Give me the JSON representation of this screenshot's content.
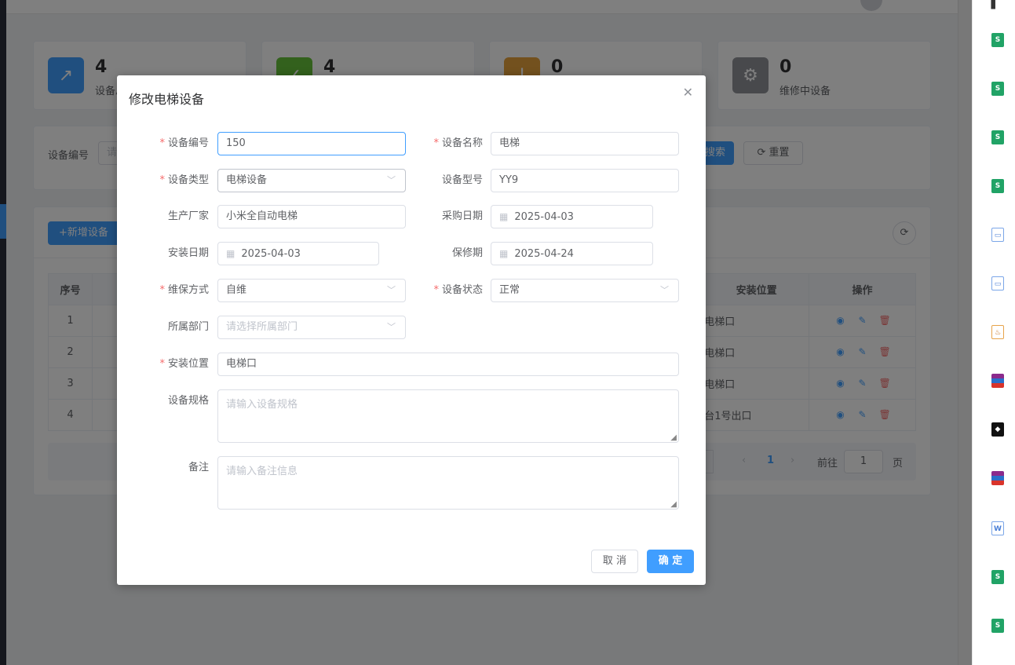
{
  "stats": [
    {
      "value": "4",
      "label": "设备总数",
      "color": "#409eff",
      "icon": "trend-up-icon"
    },
    {
      "value": "4",
      "label": "",
      "color": "#67c23a",
      "icon": "check-circle-icon"
    },
    {
      "value": "0",
      "label": "",
      "color": "#e6a23c",
      "icon": "warning-icon"
    },
    {
      "value": "0",
      "label": "维修中设备",
      "color": "#909399",
      "icon": "gear-icon"
    }
  ],
  "search": {
    "field_label": "设备编号",
    "field_placeholder": "请",
    "search_button": "搜索",
    "reset_button": "重置"
  },
  "toolbar": {
    "add_button": "新增设备"
  },
  "table": {
    "headers": {
      "index": "序号",
      "location": "安装位置",
      "actions": "操作"
    },
    "rows": [
      {
        "index": "1",
        "location": "电梯口"
      },
      {
        "index": "2",
        "location": "电梯口"
      },
      {
        "index": "3",
        "location": "电梯口"
      },
      {
        "index": "4",
        "location": "台1号出口"
      }
    ]
  },
  "pagination": {
    "current_page": "1",
    "goto_label": "前往",
    "goto_value": "1",
    "page_suffix": "页"
  },
  "dialog": {
    "title": "修改电梯设备",
    "fields": {
      "device_no": {
        "label": "设备编号",
        "value": "150"
      },
      "device_name": {
        "label": "设备名称",
        "value": "电梯"
      },
      "device_type": {
        "label": "设备类型",
        "value": "电梯设备"
      },
      "device_model": {
        "label": "设备型号",
        "value": "YY9"
      },
      "manufacturer": {
        "label": "生产厂家",
        "value": "小米全自动电梯"
      },
      "purchase_date": {
        "label": "采购日期",
        "value": "2025-04-03"
      },
      "install_date": {
        "label": "安装日期",
        "value": "2025-04-03"
      },
      "warranty": {
        "label": "保修期",
        "value": "2025-04-24"
      },
      "maintenance": {
        "label": "维保方式",
        "value": "自维"
      },
      "status": {
        "label": "设备状态",
        "value": "正常"
      },
      "department": {
        "label": "所属部门",
        "placeholder": "请选择所属部门"
      },
      "location": {
        "label": "安装位置",
        "value": "电梯口"
      },
      "spec": {
        "label": "设备规格",
        "placeholder": "请输入设备规格"
      },
      "remark": {
        "label": "备注",
        "placeholder": "请输入备注信息"
      }
    },
    "cancel_button": "取 消",
    "ok_button": "确 定"
  }
}
